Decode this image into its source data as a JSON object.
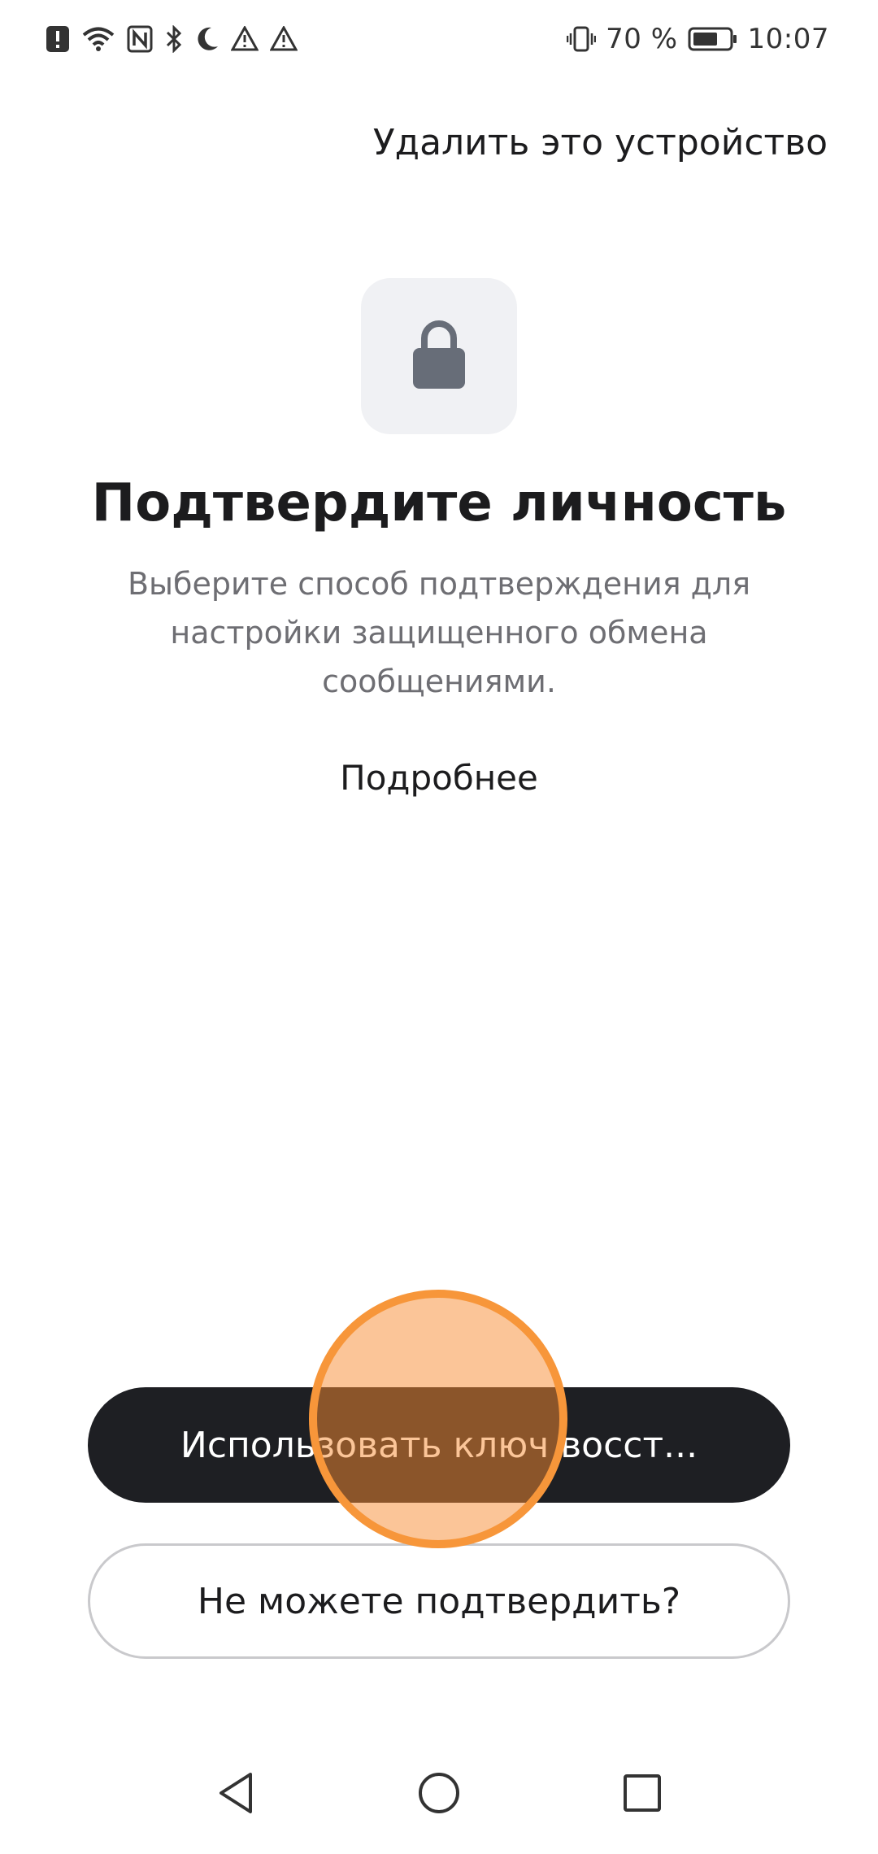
{
  "status_bar": {
    "battery_percent": "70 %",
    "time": "10:07",
    "left_icons": [
      "alert-icon",
      "wifi-icon",
      "nfc-icon",
      "bluetooth-icon",
      "moon-icon",
      "warning-icon",
      "warning-icon"
    ],
    "right_icons": [
      "vibrate-icon",
      "battery-icon"
    ],
    "battery_level": 0.7
  },
  "header": {
    "remove_device": "Удалить это устройство"
  },
  "main": {
    "icon": "lock-icon",
    "title": "Подтвердите личность",
    "subtitle": "Выберите способ подтверждения для настройки защищенного обмена сообщениями.",
    "learn_more": "Подробнее"
  },
  "actions": {
    "primary_label": "Использовать ключ восст...",
    "secondary_label": "Не можете подтвердить?"
  },
  "nav": {
    "icons": [
      "back-icon",
      "home-icon",
      "recents-icon"
    ]
  },
  "colors": {
    "primary_button": "#1e1f23",
    "touch_indicator": "#f7963a",
    "lock_tile_bg": "#f0f1f4",
    "lock_icon": "#676d78"
  }
}
